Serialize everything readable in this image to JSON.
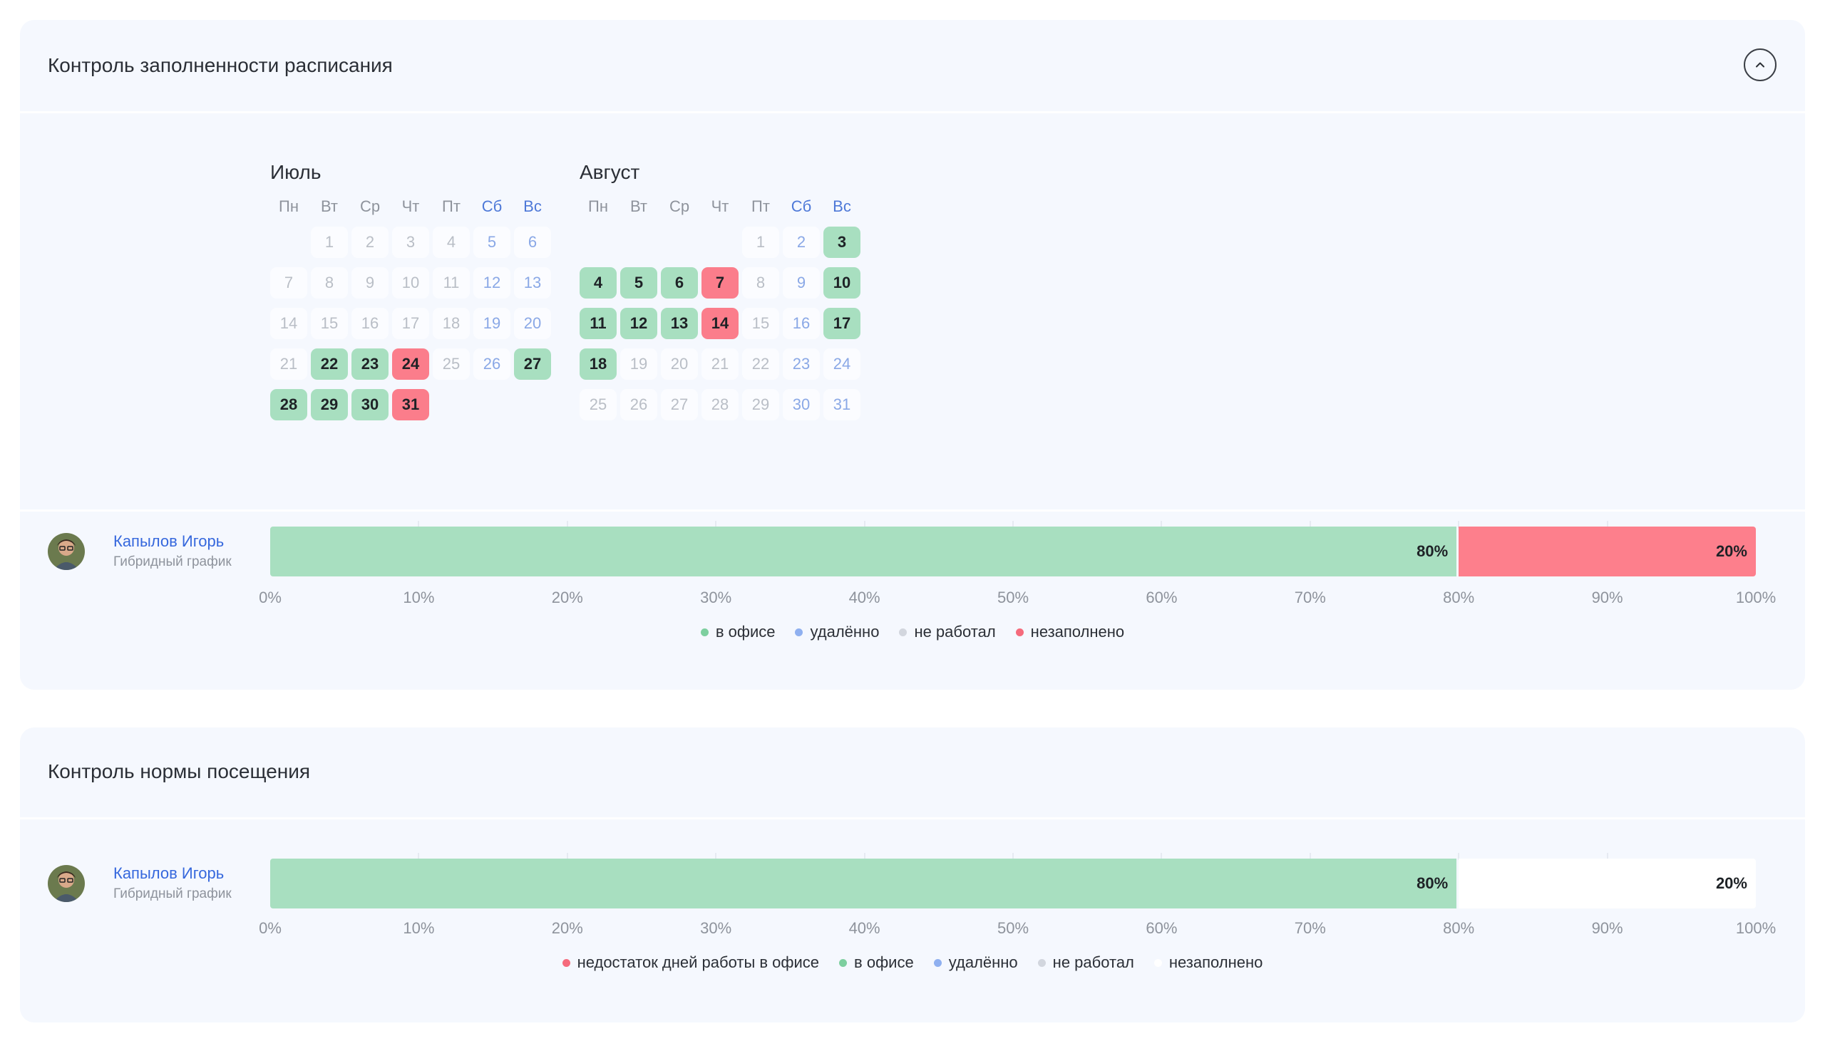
{
  "schedule_card": {
    "title": "Контроль заполненности расписания",
    "weekdays": [
      "Пн",
      "Вт",
      "Ср",
      "Чт",
      "Пт",
      "Сб",
      "Вс"
    ],
    "months": [
      {
        "name": "Июль",
        "first_weekday": 2,
        "days_in_month": 31,
        "office_days": [
          22,
          23,
          27,
          28,
          29,
          30
        ],
        "unfilled_days": [
          24,
          31
        ]
      },
      {
        "name": "Август",
        "first_weekday": 5,
        "days_in_month": 31,
        "office_days": [
          3,
          4,
          5,
          6,
          10,
          11,
          12,
          13,
          17,
          18
        ],
        "unfilled_days": [
          7,
          14
        ]
      }
    ],
    "employee": {
      "name": "Капылов Игорь",
      "schedule_type": "Гибридный график"
    },
    "bar": [
      {
        "label": "80%",
        "value": 80,
        "kind": "office"
      },
      {
        "label": "20%",
        "value": 20,
        "kind": "empty"
      }
    ],
    "legend": [
      {
        "label": "в офисе",
        "color": "#7dcf9f"
      },
      {
        "label": "удалённо",
        "color": "#8fb0f0"
      },
      {
        "label": "не работал",
        "color": "#d2d6de"
      },
      {
        "label": "незаполнено",
        "color": "#f56b7c"
      }
    ]
  },
  "attendance_card": {
    "title": "Контроль нормы посещения",
    "employee": {
      "name": "Капылов Игорь",
      "schedule_type": "Гибридный график"
    },
    "bar": [
      {
        "label": "80%",
        "value": 80,
        "kind": "office"
      },
      {
        "label": "20%",
        "value": 20,
        "kind": "white"
      }
    ],
    "legend": [
      {
        "label": "недостаток дней работы в офисе",
        "color": "#f56b7c"
      },
      {
        "label": "в офисе",
        "color": "#7dcf9f"
      },
      {
        "label": "удалённо",
        "color": "#8fb0f0"
      },
      {
        "label": "не работал",
        "color": "#d2d6de"
      },
      {
        "label": "незаполнено",
        "color": "#ffffff"
      }
    ]
  },
  "axis_ticks": [
    "0%",
    "10%",
    "20%",
    "30%",
    "40%",
    "50%",
    "60%",
    "70%",
    "80%",
    "90%",
    "100%"
  ],
  "colors": {
    "office": "#a8dfc0",
    "unfilled": "#fd7f8c",
    "link": "#3668dd",
    "weekend": "#4e79d8"
  }
}
